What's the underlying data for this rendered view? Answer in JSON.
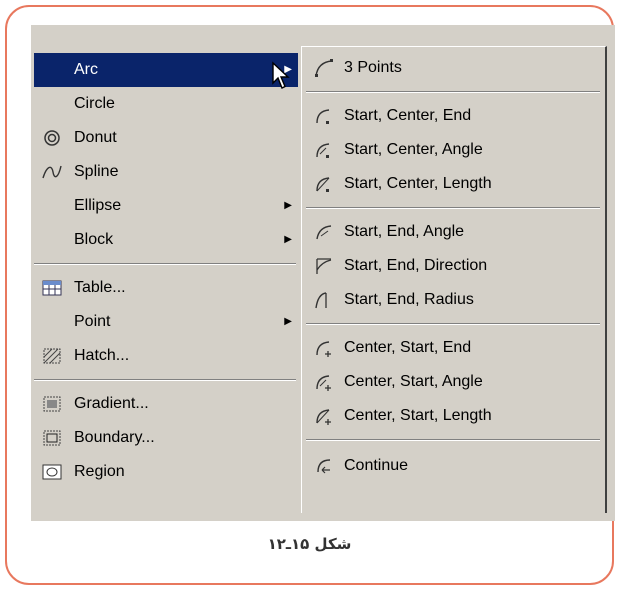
{
  "left_menu": {
    "items": [
      {
        "label": "Arc",
        "icon": "",
        "submenu": true,
        "active": true
      },
      {
        "label": "Circle",
        "icon": "",
        "submenu": false
      },
      {
        "label": "Donut",
        "icon": "donut-icon",
        "submenu": false
      },
      {
        "label": "Spline",
        "icon": "spline-icon",
        "submenu": false
      },
      {
        "label": "Ellipse",
        "icon": "",
        "submenu": true
      },
      {
        "label": "Block",
        "icon": "",
        "submenu": true
      },
      {
        "label": "Table...",
        "icon": "table-icon",
        "submenu": false
      },
      {
        "label": "Point",
        "icon": "",
        "submenu": true
      },
      {
        "label": "Hatch...",
        "icon": "hatch-icon",
        "submenu": false
      },
      {
        "label": "Gradient...",
        "icon": "gradient-icon",
        "submenu": false
      },
      {
        "label": "Boundary...",
        "icon": "boundary-icon",
        "submenu": false
      },
      {
        "label": "Region",
        "icon": "region-icon",
        "submenu": false
      }
    ]
  },
  "arc_submenu": {
    "items": [
      {
        "label": "3 Points",
        "icon": "arc-3points-icon"
      },
      {
        "label": "Start, Center, End",
        "icon": "arc-sce-icon"
      },
      {
        "label": "Start, Center, Angle",
        "icon": "arc-sca-icon"
      },
      {
        "label": "Start, Center, Length",
        "icon": "arc-scl-icon"
      },
      {
        "label": "Start, End, Angle",
        "icon": "arc-sea-icon"
      },
      {
        "label": "Start, End, Direction",
        "icon": "arc-sed-icon"
      },
      {
        "label": "Start, End, Radius",
        "icon": "arc-ser-icon"
      },
      {
        "label": "Center, Start, End",
        "icon": "arc-cse-icon"
      },
      {
        "label": "Center, Start, Angle",
        "icon": "arc-csa-icon"
      },
      {
        "label": "Center, Start, Length",
        "icon": "arc-csl-icon"
      },
      {
        "label": "Continue",
        "icon": "arc-continue-icon"
      }
    ]
  },
  "caption": "شکل ۱۵ـ۱۲",
  "colors": {
    "frame": "#e8785e",
    "menu_bg": "#d4d0c8",
    "highlight": "#0a246a"
  }
}
